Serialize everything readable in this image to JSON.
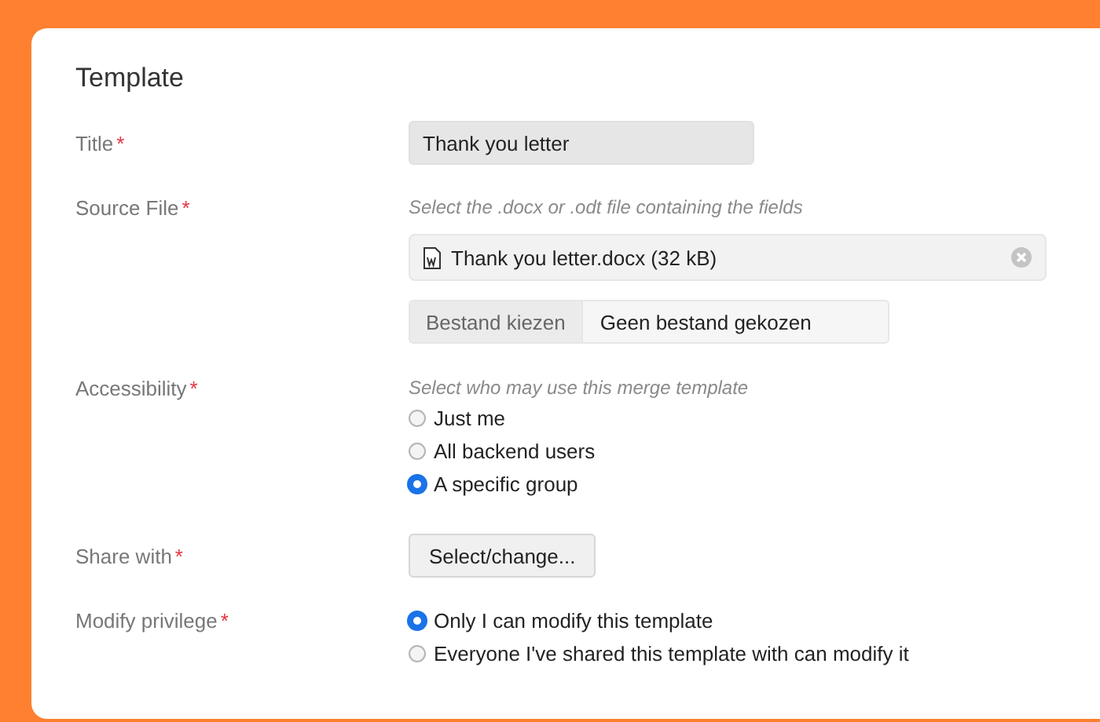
{
  "section_title": "Template",
  "fields": [
    {
      "kind": "text",
      "label": "Title",
      "required_mark": "*",
      "value": "Thank you letter"
    },
    {
      "kind": "file",
      "label": "Source File",
      "required_mark": "*",
      "hint": "Select the .docx or .odt file containing the fields",
      "file_name": "Thank you letter.docx (32 kB)",
      "choose_button": "Bestand kiezen",
      "choose_status": "Geen bestand gekozen"
    },
    {
      "kind": "radio",
      "label": "Accessibility",
      "required_mark": "*",
      "hint": "Select who may use this merge template",
      "options": [
        {
          "label": "Just me",
          "selected": false
        },
        {
          "label": "All backend users",
          "selected": false
        },
        {
          "label": "A specific group",
          "selected": true
        }
      ]
    },
    {
      "kind": "button",
      "label": "Share with",
      "required_mark": "*",
      "button": "Select/change..."
    },
    {
      "kind": "radio",
      "label": "Modify privilege",
      "required_mark": "*",
      "options": [
        {
          "label": "Only I can modify this template",
          "selected": true
        },
        {
          "label": "Everyone I've shared this template with can modify it",
          "selected": false
        }
      ]
    }
  ]
}
